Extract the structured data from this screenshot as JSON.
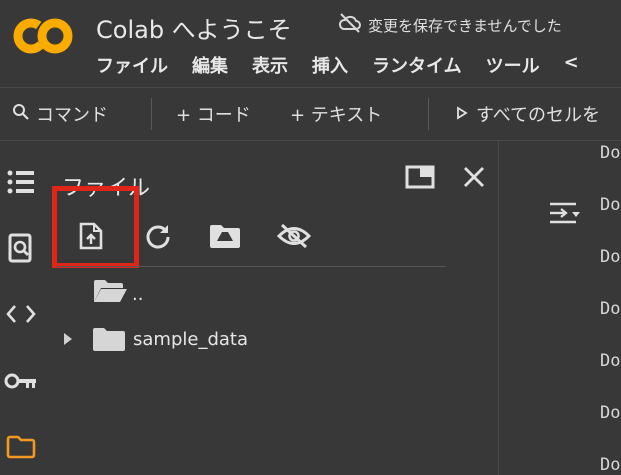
{
  "header": {
    "logo_text": "CO",
    "title": "Colab へようこそ",
    "save_status": "変更を保存できませんでした"
  },
  "menu": [
    "ファイル",
    "編集",
    "表示",
    "挿入",
    "ランタイム",
    "ツール",
    "<"
  ],
  "toolbar": {
    "command": "コマンド",
    "add_code": "+ コード",
    "add_text": "+ テキスト",
    "run_all": "すべてのセルを"
  },
  "file_panel": {
    "title": "ファイル",
    "tree": [
      {
        "label": ".."
      },
      {
        "label": "sample_data"
      }
    ]
  },
  "output_lines": [
    "Do",
    "Do",
    "Do",
    "Do",
    "Do",
    "Do",
    "Do"
  ],
  "colors": {
    "background": "#383838",
    "highlight": "#e0261b",
    "logo_orange": "#f9ab00",
    "folder_active": "#f29a1f"
  }
}
